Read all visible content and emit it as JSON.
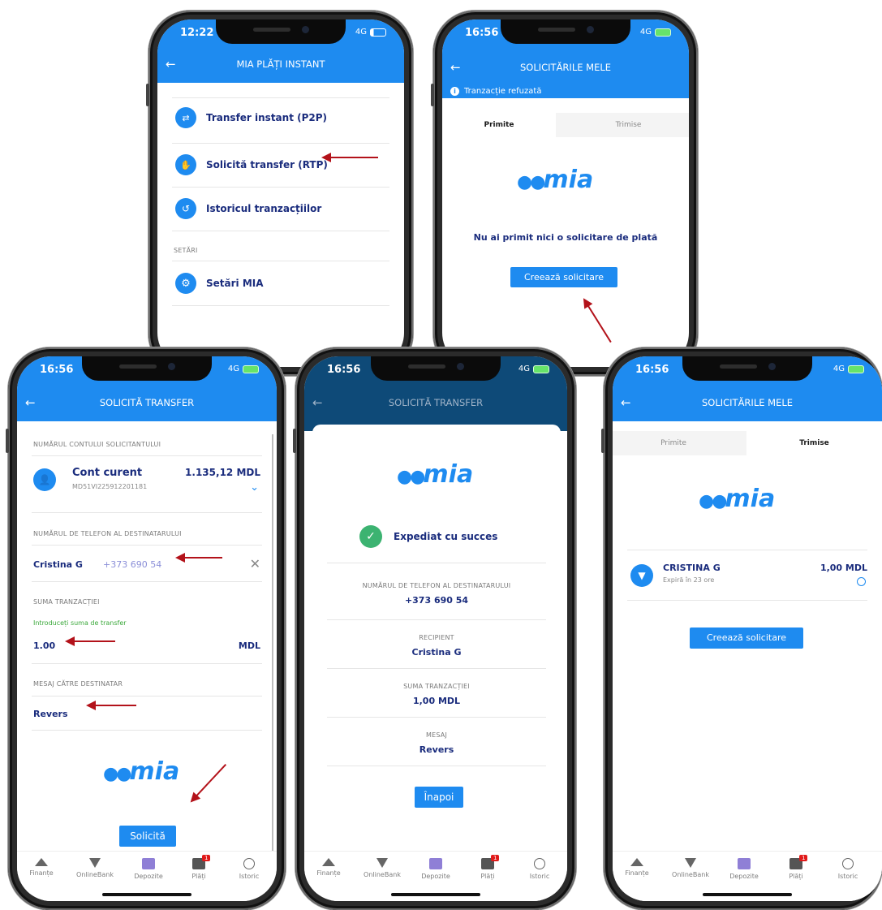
{
  "phone1": {
    "time": "12:22",
    "network": "4G",
    "title": "MIA PLĂȚI INSTANT",
    "items": [
      {
        "label": "Transfer instant (P2P)",
        "icon": "p2p-icon"
      },
      {
        "label": "Solicită transfer (RTP)",
        "icon": "hand-coin-icon"
      },
      {
        "label": "Istoricul tranzacțiilor",
        "icon": "history-icon"
      }
    ],
    "section_label": "SETĂRI",
    "settings_item": {
      "label": "Setări MIA",
      "icon": "gear-icon"
    }
  },
  "phone2": {
    "time": "16:56",
    "network": "4G",
    "title": "SOLICITĂRILE MELE",
    "banner": "Tranzacție refuzată",
    "tabs": [
      "Primite",
      "Trimise"
    ],
    "logo": "mia",
    "empty_message": "Nu ai primit nici o solicitare de plată",
    "create_button": "Creează solicitare"
  },
  "phone3": {
    "time": "16:56",
    "network": "4G",
    "title": "SOLICITĂ TRANSFER",
    "account_section_label": "NUMĂRUL CONTULUI SOLICITANTULUI",
    "account_name": "Cont curent",
    "account_iban": "MD51VI225912201181",
    "account_balance": "1.135,12 MDL",
    "phone_section_label": "NUMĂRUL DE TELEFON AL DESTINATARULUI",
    "recipient_name": "Cristina G",
    "recipient_phone": "+373 690 54",
    "amount_section_label": "SUMA TRANZACȚIEI",
    "amount_hint": "Introduceți suma de transfer",
    "amount_value": "1.00",
    "currency": "MDL",
    "message_section_label": "MESAJ CĂTRE DESTINATAR",
    "message_value": "Revers",
    "logo": "mia",
    "submit_button": "Solicită"
  },
  "phone4": {
    "time": "16:56",
    "network": "4G",
    "title": "SOLICITĂ TRANSFER",
    "logo": "mia",
    "success_text": "Expediat cu succes",
    "phone_label": "NUMĂRUL DE TELEFON AL DESTINATARULUI",
    "phone_value": "+373 690 54",
    "recipient_label": "RECIPIENT",
    "recipient_value": "Cristina G",
    "amount_label": "SUMA TRANZACȚIEI",
    "amount_value": "1,00 MDL",
    "message_label": "MESAJ",
    "message_value": "Revers",
    "back_button": "Înapoi"
  },
  "phone5": {
    "time": "16:56",
    "network": "4G",
    "title": "SOLICITĂRILE MELE",
    "tabs": [
      "Primite",
      "Trimise"
    ],
    "logo": "mia",
    "request_name": "CRISTINA G",
    "request_expiry": "Expiră în 23 ore",
    "request_amount": "1,00 MDL",
    "create_button": "Creează solicitare"
  },
  "nav": {
    "items": [
      "Finanțe",
      "OnlineBank",
      "Depozite",
      "Plăți",
      "Istoric"
    ],
    "badge": "1"
  },
  "colors": {
    "accent": "#1e8bf0",
    "text_dark_blue": "#1a2c7d",
    "arrow": "#b3121a",
    "success": "#3cb371"
  }
}
